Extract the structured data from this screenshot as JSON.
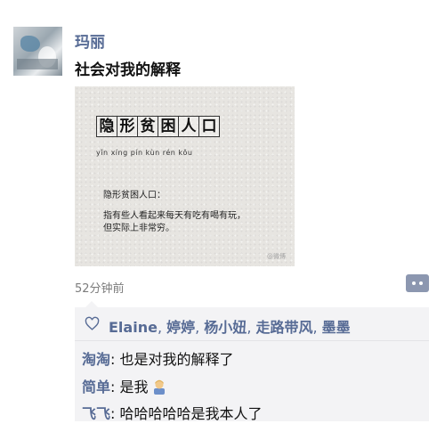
{
  "post": {
    "username": "玛丽",
    "text": "社会对我的解释",
    "image": {
      "title_chars": [
        "隐",
        "形",
        "贫",
        "困",
        "人",
        "口"
      ],
      "pinyin": "yǐn xíng pín kùn rén kǒu",
      "definition_title": "隐形贫困人口：",
      "definition_line1": "指有些人看起来每天有吃有喝有玩，",
      "definition_line2": "但实际上非常穷。",
      "watermark": "@微博"
    },
    "timestamp": "52分钟前"
  },
  "likes": {
    "icon": "heart-outline-icon",
    "names": [
      "Elaine",
      "婷婷",
      "杨小妞",
      "走路带风",
      "墨墨"
    ],
    "separator": ", "
  },
  "comments": [
    {
      "author": "淘淘",
      "text": ": 也是对我的解释了"
    },
    {
      "author": "简单",
      "text": ": 是我",
      "emoji": "person-emoji-icon"
    },
    {
      "author": "飞飞",
      "text": ": 哈哈哈哈哈是我本人了"
    }
  ],
  "colors": {
    "link": "#576b95",
    "comment_button": "#8c97b0",
    "likes_background": "#f3f3f5"
  }
}
